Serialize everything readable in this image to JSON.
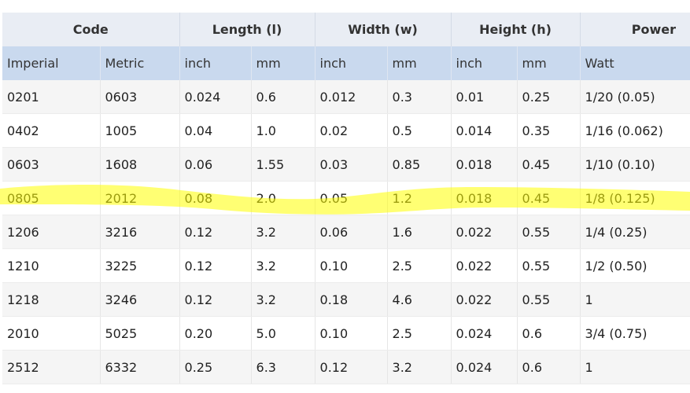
{
  "header": {
    "groups": [
      "Code",
      "Length (l)",
      "Width (w)",
      "Height (h)",
      "Power"
    ],
    "units": [
      "Imperial",
      "Metric",
      "inch",
      "mm",
      "inch",
      "mm",
      "inch",
      "mm",
      "Watt"
    ]
  },
  "rows": [
    [
      "0201",
      "0603",
      "0.024",
      "0.6",
      "0.012",
      "0.3",
      "0.01",
      "0.25",
      "1/20 (0.05)"
    ],
    [
      "0402",
      "1005",
      "0.04",
      "1.0",
      "0.02",
      "0.5",
      "0.014",
      "0.35",
      "1/16 (0.062)"
    ],
    [
      "0603",
      "1608",
      "0.06",
      "1.55",
      "0.03",
      "0.85",
      "0.018",
      "0.45",
      "1/10 (0.10)"
    ],
    [
      "0805",
      "2012",
      "0.08",
      "2.0",
      "0.05",
      "1.2",
      "0.018",
      "0.45",
      "1/8 (0.125)"
    ],
    [
      "1206",
      "3216",
      "0.12",
      "3.2",
      "0.06",
      "1.6",
      "0.022",
      "0.55",
      "1/4 (0.25)"
    ],
    [
      "1210",
      "3225",
      "0.12",
      "3.2",
      "0.10",
      "2.5",
      "0.022",
      "0.55",
      "1/2 (0.50)"
    ],
    [
      "1218",
      "3246",
      "0.12",
      "3.2",
      "0.18",
      "4.6",
      "0.022",
      "0.55",
      "1"
    ],
    [
      "2010",
      "5025",
      "0.20",
      "5.0",
      "0.10",
      "2.5",
      "0.024",
      "0.6",
      "3/4 (0.75)"
    ],
    [
      "2512",
      "6332",
      "0.25",
      "6.3",
      "0.12",
      "3.2",
      "0.024",
      "0.6",
      "1"
    ]
  ],
  "highlight": {
    "row_code": "0805",
    "color": "#ffff00"
  },
  "colors": {
    "group_header_bg": "#e9edf4",
    "unit_header_bg": "#c9d9ee",
    "row_odd_bg": "#f5f5f5",
    "row_even_bg": "#ffffff"
  }
}
